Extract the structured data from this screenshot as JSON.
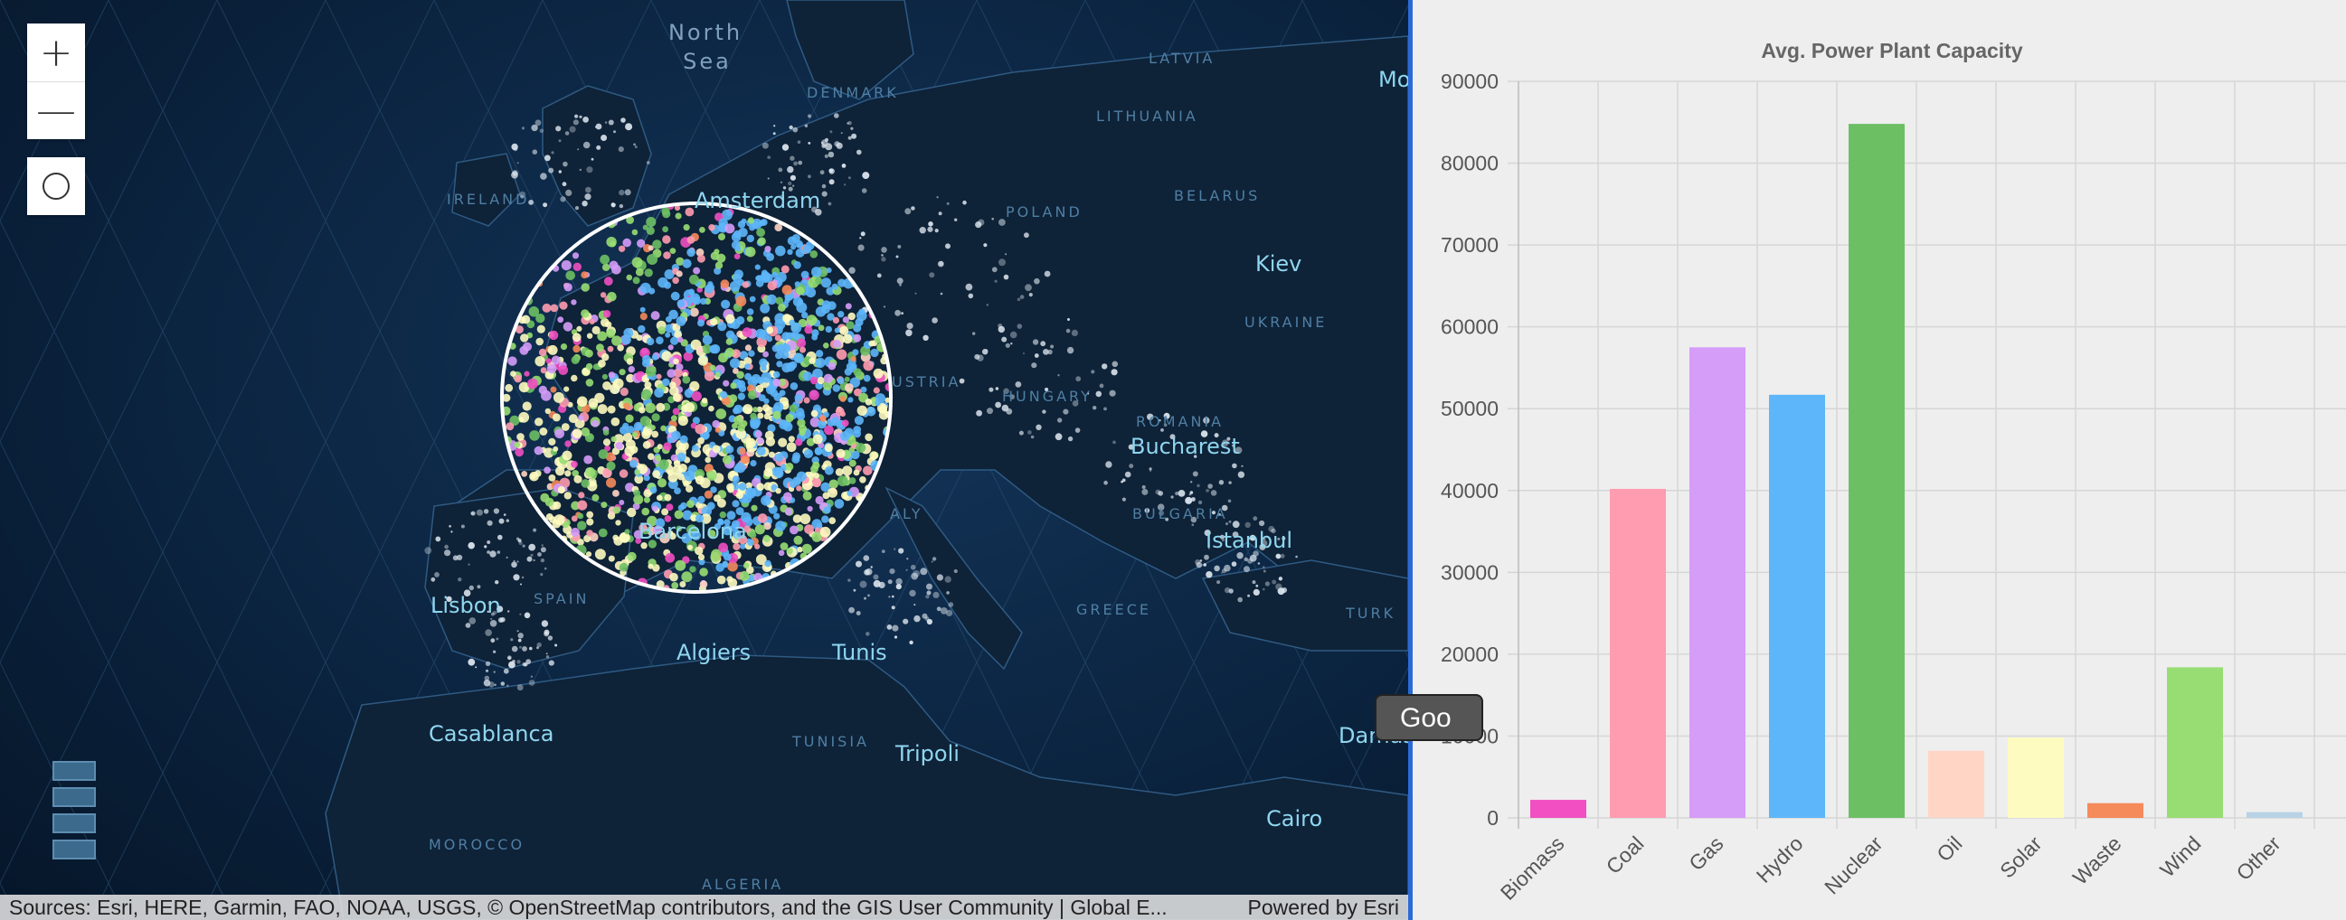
{
  "map": {
    "controls": {
      "zoom_in_icon": "plus-icon",
      "zoom_out_icon": "minus-icon",
      "zoom_in_symbol": "+",
      "zoom_out_symbol": "—",
      "circle_tool_icon": "circle-icon"
    },
    "labels": {
      "north_sea_1": "North",
      "north_sea_2": "Sea",
      "amsterdam": "Amsterdam",
      "kiev": "Kiev",
      "bucharest": "Bucharest",
      "istanbul": "Istanbul",
      "barcelona": "Barcelona",
      "lisbon": "Lisbon",
      "algiers": "Algiers",
      "tunis": "Tunis",
      "casablanca": "Casablanca",
      "tripoli": "Tripoli",
      "cairo": "Cairo",
      "damascus_partial": "Damas",
      "moscow_partial": "Mo",
      "ireland": "IRELAND",
      "denmark": "DENMARK",
      "latvia": "LATVIA",
      "lithuania": "LITHUANIA",
      "belarus": "BELARUS",
      "poland": "POLAND",
      "ukraine": "UKRAINE",
      "hungary": "HUNGARY",
      "romania": "ROMANIA",
      "bulgaria": "BULGARIA",
      "greece": "GREECE",
      "turkey_partial": "TURK",
      "spain": "SPAIN",
      "tunisia": "TUNISIA",
      "morocco": "MOROCCO",
      "algeria": "ALGERIA",
      "austria_partial": "USTRIA",
      "italy_partial": "ALY"
    },
    "attribution": {
      "text": "Sources: Esri, HERE, Garmin, FAO, NOAA, USGS, © OpenStreetMap contributors, and the GIS User Community | Global E...",
      "powered_by": "Powered by Esri"
    }
  },
  "chart_data": {
    "type": "bar",
    "title": "Avg. Power Plant Capacity",
    "categories": [
      "Biomass",
      "Coal",
      "Gas",
      "Hydro",
      "Nuclear",
      "Oil",
      "Solar",
      "Waste",
      "Wind",
      "Other"
    ],
    "values": [
      2200,
      40200,
      57500,
      51700,
      84800,
      8200,
      9800,
      1800,
      18400,
      700
    ],
    "colors": [
      "#f14fc2",
      "#ff9cb0",
      "#d59cf8",
      "#5db6f9",
      "#6dbf64",
      "#ffd5c5",
      "#fefbc0",
      "#f58a5b",
      "#98dd73",
      "#b8d2e6"
    ],
    "ylim": [
      0,
      90000
    ],
    "yticks": [
      0,
      10000,
      20000,
      30000,
      40000,
      50000,
      60000,
      70000,
      80000,
      90000
    ],
    "ytick_labels": [
      "0",
      "10000",
      "20000",
      "30000",
      "40000",
      "50000",
      "60000",
      "70000",
      "80000",
      "90000"
    ],
    "grid": true
  },
  "tooltip_button": {
    "label": "Goo"
  }
}
